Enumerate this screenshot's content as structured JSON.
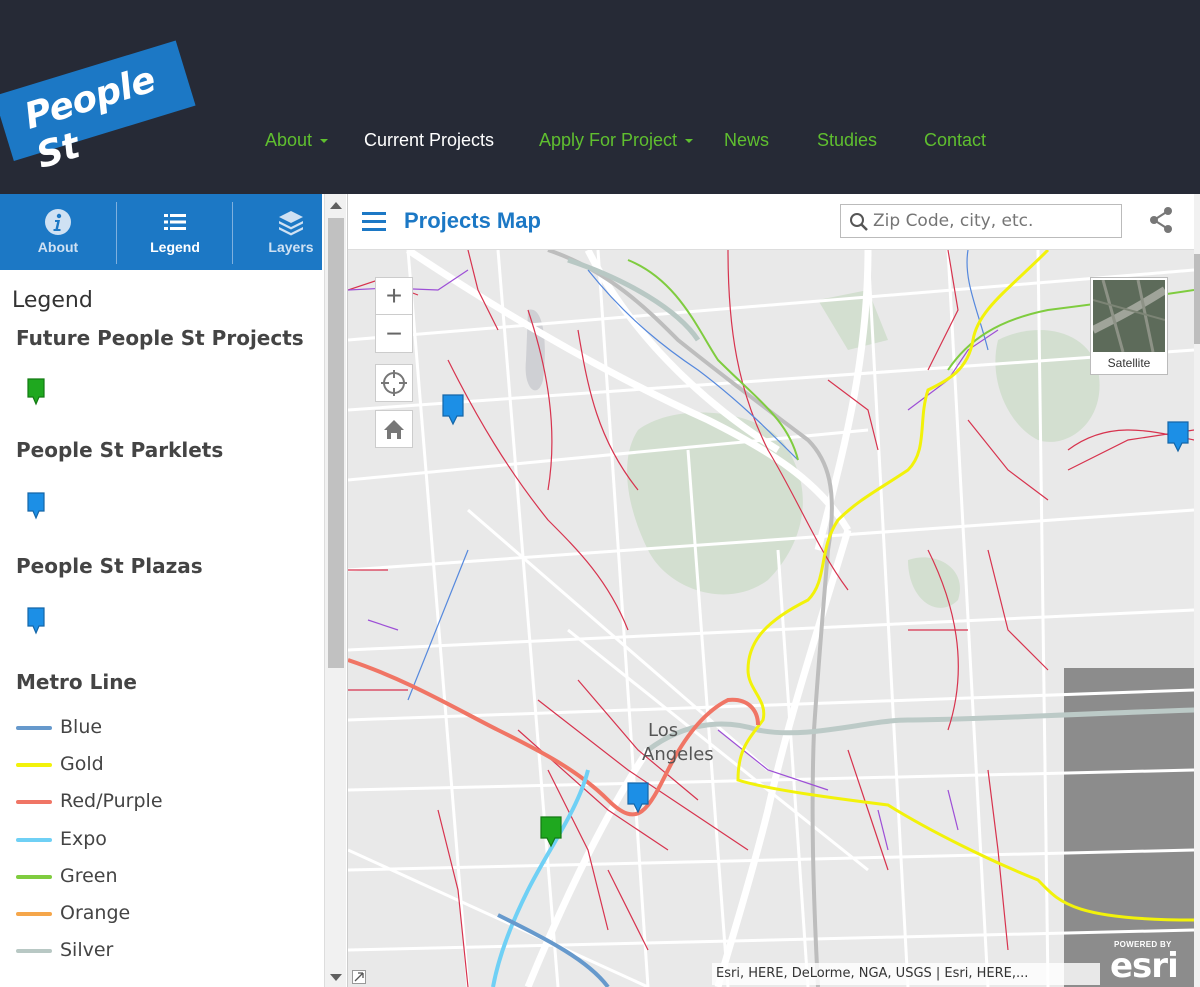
{
  "header": {
    "logo_text": "People St",
    "nav": [
      {
        "label": "About",
        "dropdown": true,
        "active": false
      },
      {
        "label": "Current Projects",
        "dropdown": false,
        "active": true
      },
      {
        "label": "Apply For Project",
        "dropdown": true,
        "active": false
      },
      {
        "label": "News",
        "dropdown": false,
        "active": false
      },
      {
        "label": "Studies",
        "dropdown": false,
        "active": false
      },
      {
        "label": "Contact",
        "dropdown": false,
        "active": false
      }
    ]
  },
  "side_panel": {
    "tabs": [
      {
        "label": "About",
        "icon": "info-icon",
        "active": false
      },
      {
        "label": "Legend",
        "icon": "list-icon",
        "active": true
      },
      {
        "label": "Layers",
        "icon": "layers-icon",
        "active": false
      }
    ],
    "legend_title": "Legend",
    "groups": [
      {
        "title": "Future People St Projects",
        "marker_color": "#1fa81f"
      },
      {
        "title": "People St Parklets",
        "marker_color": "#1c8fe6"
      },
      {
        "title": "People St Plazas",
        "marker_color": "#1c8fe6"
      }
    ],
    "metro_title": "Metro Line",
    "metro_lines": [
      {
        "label": "Blue",
        "color": "#6699cc"
      },
      {
        "label": "Gold",
        "color": "#f2f20a"
      },
      {
        "label": "Red/Purple",
        "color": "#f07565"
      },
      {
        "label": "Expo",
        "color": "#6fd0f5"
      },
      {
        "label": "Green",
        "color": "#7fcc3f"
      },
      {
        "label": "Orange",
        "color": "#f5a64a"
      },
      {
        "label": "Silver",
        "color": "#b8c8c4"
      }
    ]
  },
  "map": {
    "title": "Projects Map",
    "search_placeholder": "Zip Code, city, etc.",
    "zoom_in": "+",
    "zoom_out": "−",
    "basemap_toggle_label": "Satellite",
    "city_label_line1": "Los",
    "city_label_line2": "Angeles",
    "attribution": "Esri, HERE, DeLorme, NGA, USGS | Esri, HERE,...",
    "esri_powered": "POWERED BY",
    "esri_logo": "esri"
  },
  "colors": {
    "header_bg": "#262a36",
    "brand_blue": "#1c78c5",
    "nav_green": "#5fbf2f"
  }
}
